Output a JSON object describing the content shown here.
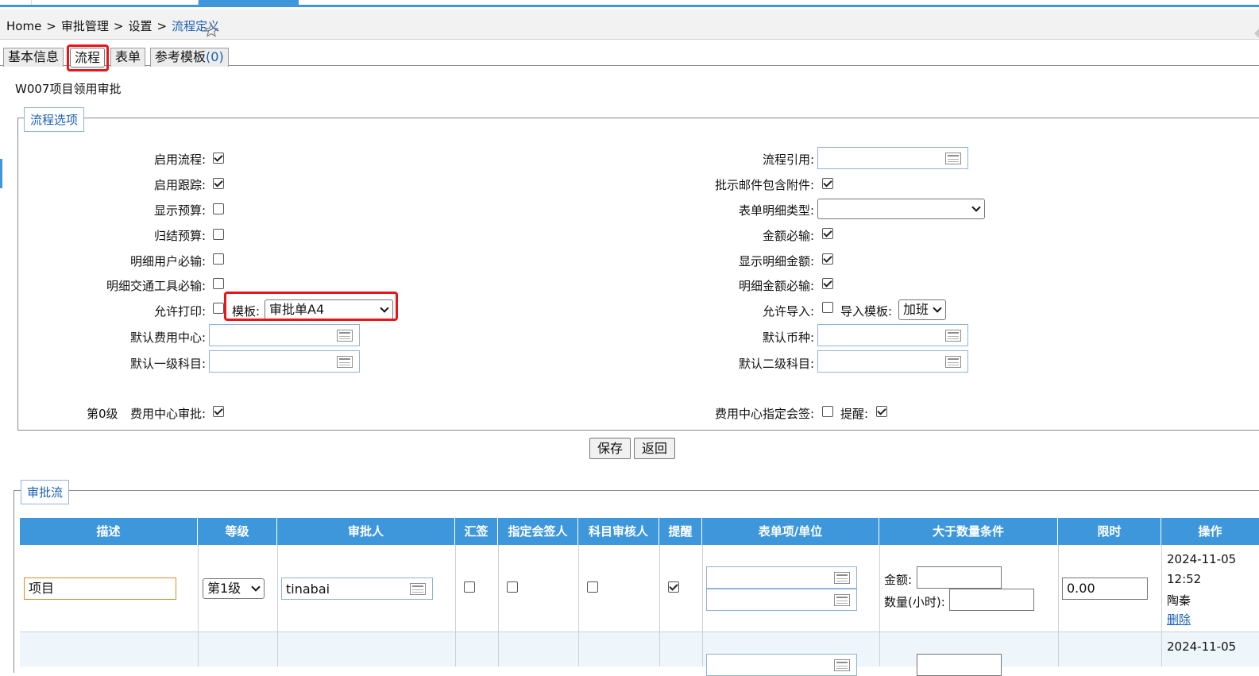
{
  "breadcrumb": {
    "items": [
      "Home",
      "审批管理",
      "设置"
    ],
    "current": "流程定义",
    "separator": ">"
  },
  "tabs": [
    {
      "label": "基本信息"
    },
    {
      "label": "流程"
    },
    {
      "label": "表单"
    },
    {
      "label": "参考模板",
      "count": "(0)"
    }
  ],
  "page_title": "W007项目领用审批",
  "options": {
    "legend": "流程选项",
    "left": {
      "enable_flow": {
        "label": "启用流程:",
        "checked": true
      },
      "enable_tracking": {
        "label": "启用跟踪:",
        "checked": true
      },
      "show_budget": {
        "label": "显示预算:",
        "checked": false
      },
      "close_budget": {
        "label": "归结预算:",
        "checked": false
      },
      "detail_user_required": {
        "label": "明细用户必输:",
        "checked": false
      },
      "detail_transport_required": {
        "label": "明细交通工具必输:",
        "checked": false
      },
      "allow_print": {
        "label": "允许打印:",
        "checked": false
      },
      "template_label": "模板:",
      "template_value": "审批单A4",
      "default_cost_center": {
        "label": "默认费用中心:",
        "value": ""
      },
      "default_level1_account": {
        "label": "默认一级科目:",
        "value": ""
      },
      "level_prefix": "第0级",
      "cost_center_approval": {
        "label": "费用中心审批:",
        "checked": true
      }
    },
    "right": {
      "flow_reference": {
        "label": "流程引用:",
        "value": ""
      },
      "mail_attachment": {
        "label": "批示邮件包含附件:",
        "checked": true
      },
      "detail_type": {
        "label": "表单明细类型:",
        "value": ""
      },
      "amount_required": {
        "label": "金额必输:",
        "checked": true
      },
      "show_detail_amount": {
        "label": "显示明细金额:",
        "checked": true
      },
      "detail_amount_required": {
        "label": "明细金额必输:",
        "checked": true
      },
      "allow_import": {
        "label": "允许导入:",
        "checked": false
      },
      "import_template_label": "导入模板:",
      "import_template_value": "加班",
      "default_currency": {
        "label": "默认币种:",
        "value": ""
      },
      "default_level2_account": {
        "label": "默认二级科目:",
        "value": ""
      },
      "cost_center_countersign": {
        "label": "费用中心指定会签:",
        "checked": false
      },
      "remind": {
        "label": "提醒:",
        "checked": true
      }
    }
  },
  "buttons": {
    "save": "保存",
    "back": "返回"
  },
  "approval_flow": {
    "legend": "审批流",
    "columns": [
      "描述",
      "等级",
      "审批人",
      "汇签",
      "指定会签人",
      "科目审核人",
      "提醒",
      "表单项/单位",
      "大于数量条件",
      "限时",
      "操作"
    ],
    "rows": [
      {
        "description": "项目",
        "level": "第1级",
        "approver": "tinabai",
        "countersign": false,
        "designated_countersigner": false,
        "account_reviewer": false,
        "remind": true,
        "amount_label": "金额:",
        "amount_value": "",
        "qty_label": "数量(小时):",
        "qty_value": "",
        "time_limit": "0.00",
        "op_date": "2024-11-05",
        "op_time": "12:52",
        "op_user": "陶秦",
        "op_delete": "删除"
      },
      {
        "op_date": "2024-11-05"
      }
    ]
  },
  "colors": {
    "accent": "#3e97db",
    "highlight": "#e8161b",
    "link": "#1a5fb4"
  }
}
